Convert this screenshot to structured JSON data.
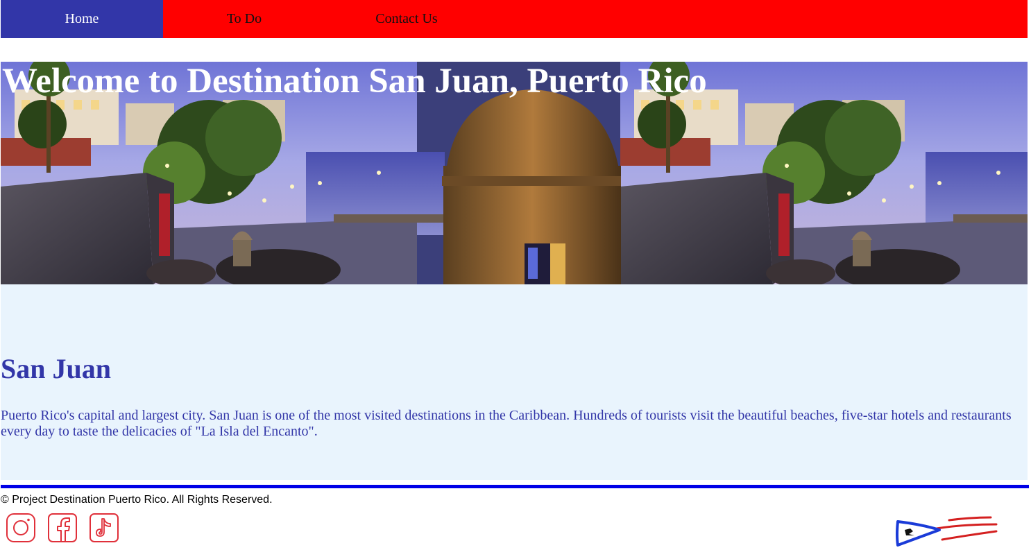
{
  "nav": {
    "items": [
      {
        "label": "Home",
        "active": true
      },
      {
        "label": "To Do",
        "active": false
      },
      {
        "label": "Contact Us",
        "active": false
      }
    ]
  },
  "hero": {
    "title": "Welcome to Destination San Juan, Puerto Rico"
  },
  "content": {
    "heading": "San Juan",
    "paragraph": "Puerto Rico's capital and largest city. San Juan is one of the most visited destinations in the Caribbean. Hundreds of tourists visit the beautiful beaches, five-star hotels and restaurants every day to taste the delicacies of \"La Isla del Encanto\"."
  },
  "footer": {
    "copyright": "© Project Destination Puerto Rico. All Rights Reserved.",
    "social": [
      {
        "icon": "instagram-icon"
      },
      {
        "icon": "facebook-icon"
      },
      {
        "icon": "tiktok-icon"
      }
    ],
    "logo_icon": "puerto-rico-flag-logo-icon"
  },
  "colors": {
    "nav_bg": "#ff0000",
    "nav_active": "#3236a8",
    "content_bg": "#e9f4fd",
    "heading_text": "#3236a8",
    "footer_rule": "#0000e6",
    "social_icon": "#e0303a"
  }
}
